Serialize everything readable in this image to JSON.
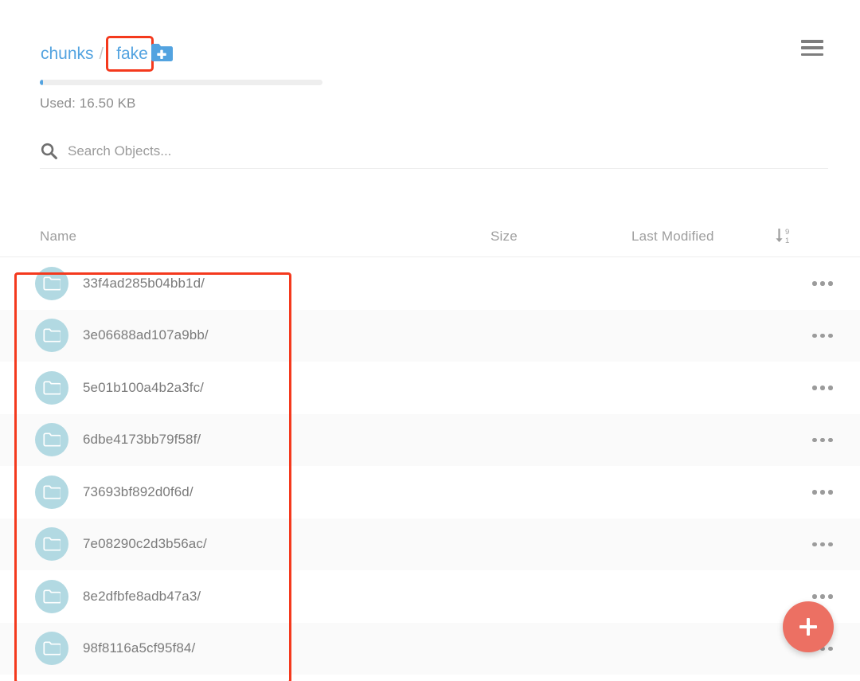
{
  "header": {
    "breadcrumb": {
      "root_label": "chunks",
      "separator": "/",
      "current_label": "fake",
      "trailing_separator": "/"
    },
    "new_folder_icon": "folder-plus-icon",
    "menu_icon": "hamburger-menu-icon"
  },
  "storage": {
    "used_label": "Used: 16.50 KB",
    "used_percent": 1,
    "bar_track_color": "#eeeeee",
    "bar_fill_color": "#53a3e0"
  },
  "search": {
    "placeholder": "Search Objects...",
    "value": "",
    "icon": "search-icon"
  },
  "table": {
    "columns": {
      "name": "Name",
      "size": "Size",
      "last_modified": "Last Modified"
    },
    "sort_icon": "sort-descending-icon",
    "rows": [
      {
        "name": "33f4ad285b04bb1d/",
        "size": "",
        "last_modified": "",
        "type": "folder"
      },
      {
        "name": "3e06688ad107a9bb/",
        "size": "",
        "last_modified": "",
        "type": "folder"
      },
      {
        "name": "5e01b100a4b2a3fc/",
        "size": "",
        "last_modified": "",
        "type": "folder"
      },
      {
        "name": "6dbe4173bb79f58f/",
        "size": "",
        "last_modified": "",
        "type": "folder"
      },
      {
        "name": "73693bf892d0f6d/",
        "size": "",
        "last_modified": "",
        "type": "folder"
      },
      {
        "name": "7e08290c2d3b56ac/",
        "size": "",
        "last_modified": "",
        "type": "folder"
      },
      {
        "name": "8e2dfbfe8adb47a3/",
        "size": "",
        "last_modified": "",
        "type": "folder"
      },
      {
        "name": "98f8116a5cf95f84/",
        "size": "",
        "last_modified": "",
        "type": "folder"
      }
    ]
  },
  "fab": {
    "icon": "plus-icon",
    "color": "#ec7063"
  },
  "annotations": {
    "highlight_color": "#f4391d",
    "breadcrumb_box": "fake",
    "rows_box": "folder-list"
  },
  "colors": {
    "link": "#53a3e0",
    "folder_icon_bg": "#b2d9e2",
    "row_alt_bg": "#fafafa",
    "text_muted": "#9e9e9e"
  }
}
